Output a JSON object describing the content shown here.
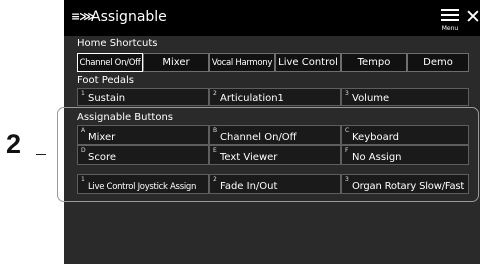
{
  "callout": {
    "number": "2"
  },
  "window": {
    "title": "Assignable",
    "logo_text": "≡⋙",
    "menu_label": "Menu",
    "close_glyph": "✕"
  },
  "home_shortcuts": {
    "label": "Home Shortcuts",
    "buttons": [
      "Channel On/Off",
      "Mixer",
      "Vocal Harmony",
      "Live Control",
      "Tempo",
      "Demo"
    ]
  },
  "foot_pedals": {
    "label": "Foot Pedals",
    "items": [
      {
        "index": "1",
        "label": "Sustain"
      },
      {
        "index": "2",
        "label": "Articulation1"
      },
      {
        "index": "3",
        "label": "Volume"
      }
    ]
  },
  "assignable_buttons": {
    "label": "Assignable Buttons",
    "items": [
      {
        "index": "A",
        "label": "Mixer"
      },
      {
        "index": "B",
        "label": "Channel On/Off"
      },
      {
        "index": "C",
        "label": "Keyboard"
      },
      {
        "index": "D",
        "label": "Score"
      },
      {
        "index": "E",
        "label": "Text Viewer"
      },
      {
        "index": "F",
        "label": "No Assign"
      }
    ],
    "live_control": [
      {
        "index": "1",
        "label": "Live Control Joystick Assign"
      },
      {
        "index": "2",
        "label": "Fade In/Out"
      },
      {
        "index": "3",
        "label": "Organ Rotary Slow/Fast"
      }
    ]
  }
}
